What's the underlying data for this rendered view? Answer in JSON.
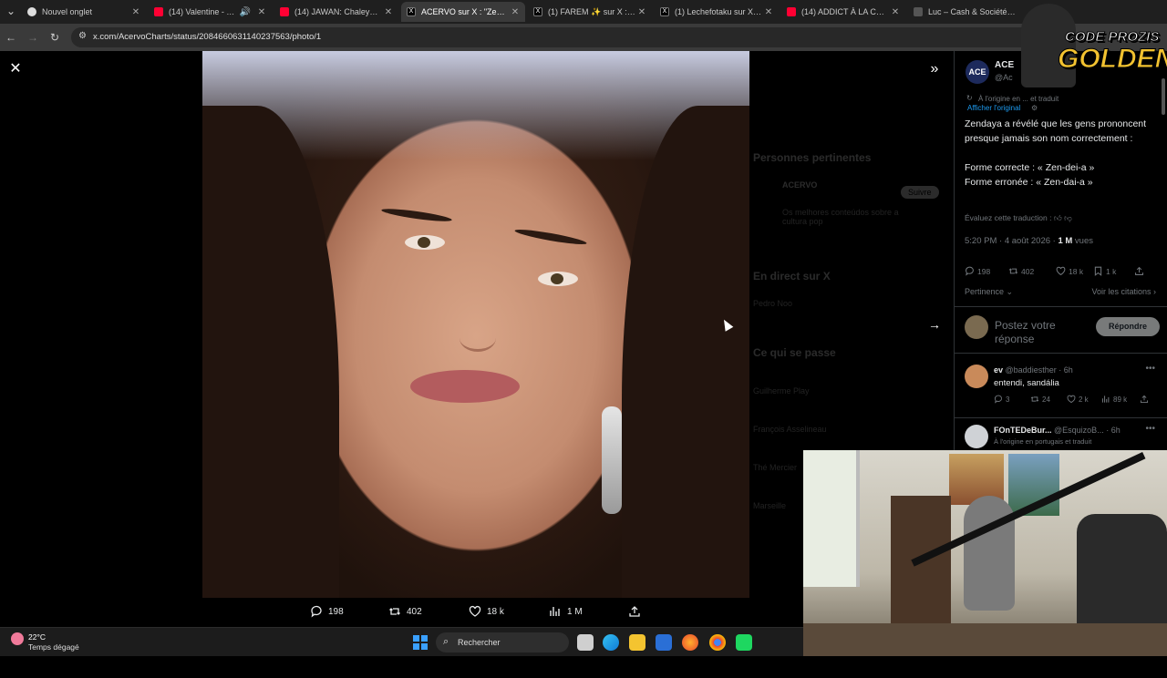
{
  "browser": {
    "tabs": [
      {
        "label": "Nouvel onglet",
        "favicon": "chrome-icon",
        "active": false
      },
      {
        "label": "(14) Valentine - YouTube",
        "favicon": "youtube-icon",
        "active": false,
        "audio": true
      },
      {
        "label": "(14) JAWAN: Chaleya (Hindi)",
        "favicon": "youtube-icon",
        "active": false
      },
      {
        "label": "ACERVO sur X : \"Zendaya",
        "favicon": "x-icon",
        "active": true
      },
      {
        "label": "(1) FAREM ✨ sur X : \"Ajo",
        "favicon": "x-icon",
        "active": false
      },
      {
        "label": "(1) Lechefotaku sur X : \"G",
        "favicon": "x-icon",
        "active": false
      },
      {
        "label": "(14) ADDICT À LA COCA",
        "favicon": "youtube-icon",
        "active": false
      },
      {
        "label": "Luc – Cash & Société can",
        "favicon": "page-icon",
        "active": false
      }
    ],
    "close_glyph": "✕",
    "url": "x.com/AcervoCharts/status/2084660631140237563/photo/1"
  },
  "viewer": {
    "close_glyph": "✕",
    "expand_glyph": "»",
    "next_glyph": "→",
    "actions": {
      "replies": "198",
      "reposts": "402",
      "likes": "18 k",
      "views": "1 M"
    }
  },
  "background_sidebar": {
    "relevant_title": "Personnes pertinentes",
    "relevant_name": "ACERVO",
    "follow_label": "Suivre",
    "bio": "Os melhores conteúdos sobre a cultura pop",
    "live_title": "En direct sur X",
    "live_item": "Pedro Noo",
    "trends_title": "Ce qui se passe",
    "trends": [
      "Guilherme Play",
      "François Asselineau",
      "Thé Mercier",
      "Marseille"
    ]
  },
  "tweet": {
    "avatar_initials": "ACE",
    "author": "ACE",
    "handle": "@Ac",
    "translated_note": "À l'origine en ... et traduit",
    "show_original": "Afficher l'original",
    "text": "Zendaya a révélé que les gens prononcent presque jamais son nom correctement :\n\nForme correcte : « Zen-dei-a »\nForme erronée : « Zen-dai-a »",
    "rate_translation": "Évaluez cette traduction :",
    "time": "5:20 PM · 4 août 2026 · ",
    "views_count": "1 M",
    "views_label": " vues",
    "stats": {
      "replies": "198",
      "reposts": "402",
      "likes": "18 k",
      "bookmarks": "1 k"
    },
    "sort_label": "Pertinence ⌄",
    "quotes_label": "Voir les citations ›",
    "reply_placeholder": "Postez votre réponse",
    "reply_button": "Répondre"
  },
  "replies": [
    {
      "name": "ev",
      "handle": "@baddiesther · 6h",
      "text": "entendi, sandália",
      "stats": {
        "replies": "3",
        "reposts": "24",
        "likes": "2 k",
        "views": "89 k"
      },
      "avatar_color": "#c98a5a"
    },
    {
      "name": "FOnTEDeBur...",
      "handle": "@EsquizoB... · 6h",
      "text": "À l'origine en portugais et traduit",
      "avatar_color": "#cfd2d6"
    }
  ],
  "overlay": {
    "logo_line1": "CODE PROZIS",
    "logo_line2": "GOLDENG"
  },
  "taskbar": {
    "temperature": "22°C",
    "weather": "Temps dégagé",
    "search_label": "Rechercher"
  },
  "colors": {
    "accent": "#1d9bf0",
    "muted": "#71767b",
    "reply_button": "#787a7a",
    "logo_gold": "#f2c230"
  }
}
